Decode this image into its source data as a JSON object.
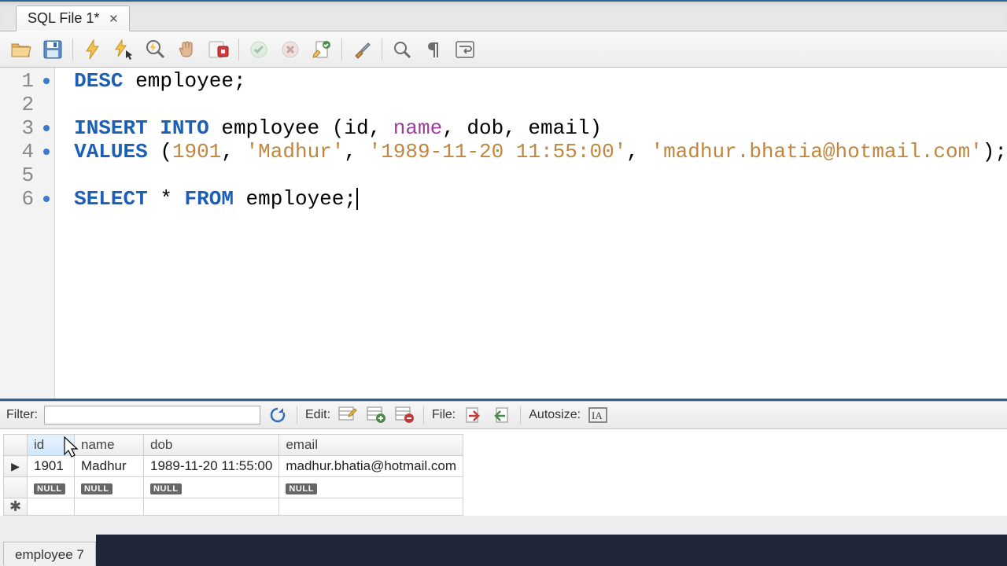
{
  "tabs": {
    "file": "SQL File 1*"
  },
  "editor": {
    "lines": [
      "1",
      "2",
      "3",
      "4",
      "5",
      "6"
    ],
    "dots": [
      true,
      false,
      true,
      true,
      false,
      true
    ],
    "code": {
      "l1": {
        "kw": "DESC",
        "rest": " employee;"
      },
      "l3": {
        "kw": "INSERT INTO",
        "rest1": " employee (id, ",
        "nm": "name",
        "rest2": ", dob, email)"
      },
      "l4": {
        "kw": "VALUES",
        "lp": " (",
        "n1": "1901",
        "c1": ", ",
        "s1": "'Madhur'",
        "c2": ", ",
        "s2": "'1989-11-20 11:55:00'",
        "c3": ", ",
        "s3": "'madhur.bhatia@hotmail.com'",
        "rp": ");"
      },
      "l6": {
        "kw1": "SELECT",
        "mid": " * ",
        "kw2": "FROM",
        "rest": " employee;"
      }
    }
  },
  "resultbar": {
    "filter_label": "Filter:",
    "edit_label": "Edit:",
    "file_label": "File:",
    "autosize_label": "Autosize:"
  },
  "grid": {
    "headers": [
      "id",
      "name",
      "dob",
      "email"
    ],
    "row": {
      "id": "1901",
      "name": "Madhur",
      "dob": "1989-11-20 11:55:00",
      "email": "madhur.bhatia@hotmail.com"
    },
    "null": "NULL"
  },
  "bottom": {
    "tab": "employee 7"
  }
}
